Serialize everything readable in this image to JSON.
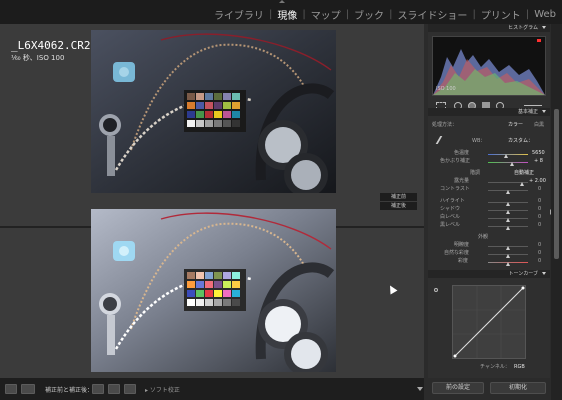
{
  "topbar": {
    "modules": [
      "ライブラリ",
      "現像",
      "マップ",
      "ブック",
      "スライドショー",
      "プリント",
      "Web"
    ],
    "active": "現像"
  },
  "photo_info": {
    "filename": "_L6X4062.CR2",
    "exposure": "¹⁄₆₀ 秒、ISO 100"
  },
  "compare": {
    "before_tag": "補正前",
    "after_tag": "補正後"
  },
  "bottom_toolbar": {
    "compare_label": "補正前と補正後：",
    "soft_proof": "ソフト校正"
  },
  "right_panel": {
    "histogram_title": "ヒストグラム",
    "histogram_info": "ISO 100",
    "basic_title": "基本補正",
    "treatment_label": "処理方法：",
    "treatment_color": "カラー",
    "treatment_bw": "白黒",
    "wb_label": "WB：",
    "wb_value": "カスタム：",
    "temp_label": "色温度",
    "temp_value": "5650",
    "tint_label": "色かぶり補正",
    "tint_value": "+ 8",
    "tone_label": "階調",
    "auto_tone": "自動補正",
    "exposure_label": "露光量",
    "exposure_value": "+ 2.00",
    "contrast_label": "コントラスト",
    "contrast_value": "0",
    "highlights_label": "ハイライト",
    "highlights_value": "0",
    "shadows_label": "シャドウ",
    "shadows_value": "0",
    "whites_label": "白レベル",
    "whites_value": "0",
    "blacks_label": "黒レベル",
    "blacks_value": "0",
    "presence_label": "外観",
    "clarity_label": "明瞭度",
    "clarity_value": "0",
    "vibrance_label": "自然な彩度",
    "vibrance_value": "0",
    "saturation_label": "彩度",
    "saturation_value": "0",
    "tone_curve_title": "トーンカーブ",
    "channel_label": "チャンネル：",
    "channel_value": "RGB",
    "prev_button": "前の設定",
    "reset_button": "初期化"
  },
  "colors": {
    "accent_white": "#ffffff",
    "panel_bg": "#2f2f2f",
    "stage_bg": "#3b3b3b"
  }
}
